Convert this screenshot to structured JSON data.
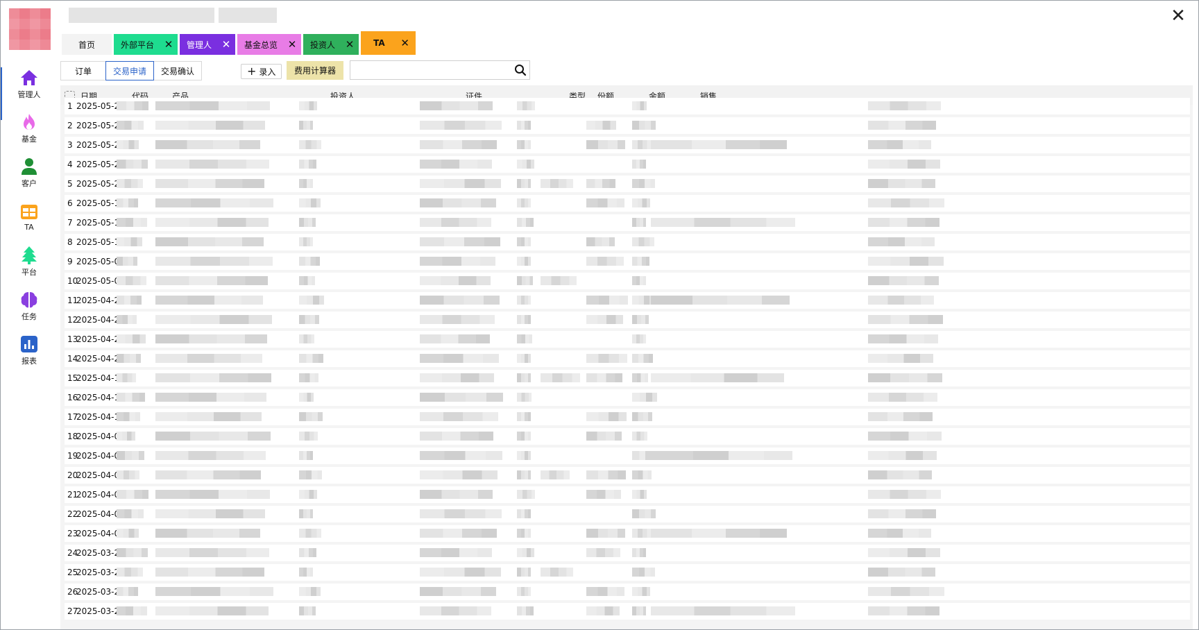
{
  "tabs": {
    "home": "首页",
    "items": [
      {
        "label": "外部平台",
        "color": "#1edc8f"
      },
      {
        "label": "管理人",
        "color": "#7a2fe0"
      },
      {
        "label": "基金总览",
        "color": "#e87ce6"
      },
      {
        "label": "投资人",
        "color": "#2fb05c"
      },
      {
        "label": "TA",
        "color": "#fba31c"
      }
    ],
    "close_glyph": "✕"
  },
  "sidebar": {
    "items": [
      {
        "label": "管理人",
        "icon": "home-icon",
        "color": "#7a2fe0"
      },
      {
        "label": "基金",
        "icon": "flame-icon",
        "color": "#e86ae8"
      },
      {
        "label": "客户",
        "icon": "person-icon",
        "color": "#1f8f35"
      },
      {
        "label": "TA",
        "icon": "table-icon",
        "color": "#fba31c"
      },
      {
        "label": "平台",
        "icon": "tree-icon",
        "color": "#1edc8f"
      },
      {
        "label": "任务",
        "icon": "brain-icon",
        "color": "#8a3fe0"
      },
      {
        "label": "报表",
        "icon": "chart-icon",
        "color": "#2b63c9"
      }
    ]
  },
  "toolbar": {
    "subtabs": [
      "订单",
      "交易申请",
      "交易确认"
    ],
    "active_subtab": "交易申请",
    "add_label": "录入",
    "calc_label": "费用计算器",
    "search_placeholder": ""
  },
  "table": {
    "columns": [
      "日期",
      "代码",
      "产品",
      "投资人",
      "证件",
      "类型",
      "份额",
      "金额",
      "销售"
    ],
    "rows": [
      {
        "num": "1",
        "date": "2025-05-27"
      },
      {
        "num": "2",
        "date": "2025-05-27"
      },
      {
        "num": "3",
        "date": "2025-05-27"
      },
      {
        "num": "4",
        "date": "2025-05-27"
      },
      {
        "num": "5",
        "date": "2025-05-21"
      },
      {
        "num": "6",
        "date": "2025-05-19"
      },
      {
        "num": "7",
        "date": "2025-05-14"
      },
      {
        "num": "8",
        "date": "2025-05-13"
      },
      {
        "num": "9",
        "date": "2025-05-09"
      },
      {
        "num": "10",
        "date": "2025-05-06"
      },
      {
        "num": "11",
        "date": "2025-04-29"
      },
      {
        "num": "12",
        "date": "2025-04-24"
      },
      {
        "num": "13",
        "date": "2025-04-24"
      },
      {
        "num": "14",
        "date": "2025-04-24"
      },
      {
        "num": "15",
        "date": "2025-04-15"
      },
      {
        "num": "16",
        "date": "2025-04-15"
      },
      {
        "num": "17",
        "date": "2025-04-15"
      },
      {
        "num": "18",
        "date": "2025-04-09"
      },
      {
        "num": "19",
        "date": "2025-04-07"
      },
      {
        "num": "20",
        "date": "2025-04-03"
      },
      {
        "num": "21",
        "date": "2025-04-01"
      },
      {
        "num": "22",
        "date": "2025-04-01"
      },
      {
        "num": "23",
        "date": "2025-04-01"
      },
      {
        "num": "24",
        "date": "2025-03-28"
      },
      {
        "num": "25",
        "date": "2025-03-28"
      },
      {
        "num": "26",
        "date": "2025-03-25"
      },
      {
        "num": "27",
        "date": "2025-03-25"
      }
    ]
  }
}
